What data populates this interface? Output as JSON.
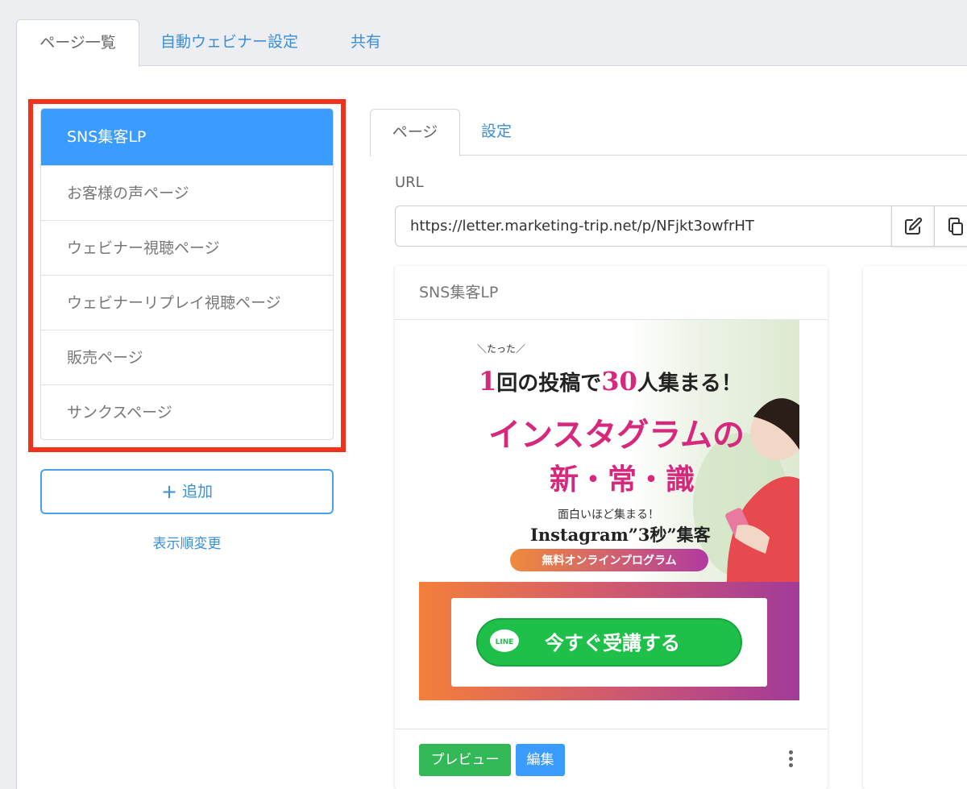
{
  "top_tabs": [
    "ページ一覧",
    "自動ウェビナー設定",
    "共有"
  ],
  "pages": [
    "SNS集客LP",
    "お客様の声ページ",
    "ウェビナー視聴ページ",
    "ウェビナーリプレイ視聴ページ",
    "販売ページ",
    "サンクスページ"
  ],
  "add_button": {
    "icon": "+",
    "label": "追加"
  },
  "reorder_link": "表示順変更",
  "inner_tabs": [
    "ページ",
    "設定"
  ],
  "url": {
    "label": "URL",
    "value": "https://letter.marketing-trip.net/p/NFjkt3owfrHT"
  },
  "card": {
    "title": "SNS集客LP",
    "preview_label": "プレビュー",
    "edit_label": "編集"
  },
  "lp": {
    "small": "＼たった／",
    "h1_num1": "1",
    "h1_mid": "回の投稿で",
    "h1_num2": "30",
    "h1_end": "人集まる！",
    "main_title_line1": "インスタグラムの",
    "main_title_line2": "新・常・識",
    "sub1": "面白いほど集まる！",
    "sub2": "Instagram”3秒”集客",
    "ribbon": "無料オンラインプログラム",
    "line_badge": "LINE",
    "cta": "今すぐ受講する"
  },
  "colors": {
    "accent_blue": "#3b9cff",
    "link_blue": "#3a8fd6",
    "highlight_red": "#f2311a",
    "preview_green": "#32b857",
    "lp_pink": "#d6287d",
    "line_green": "#1ec04a"
  }
}
